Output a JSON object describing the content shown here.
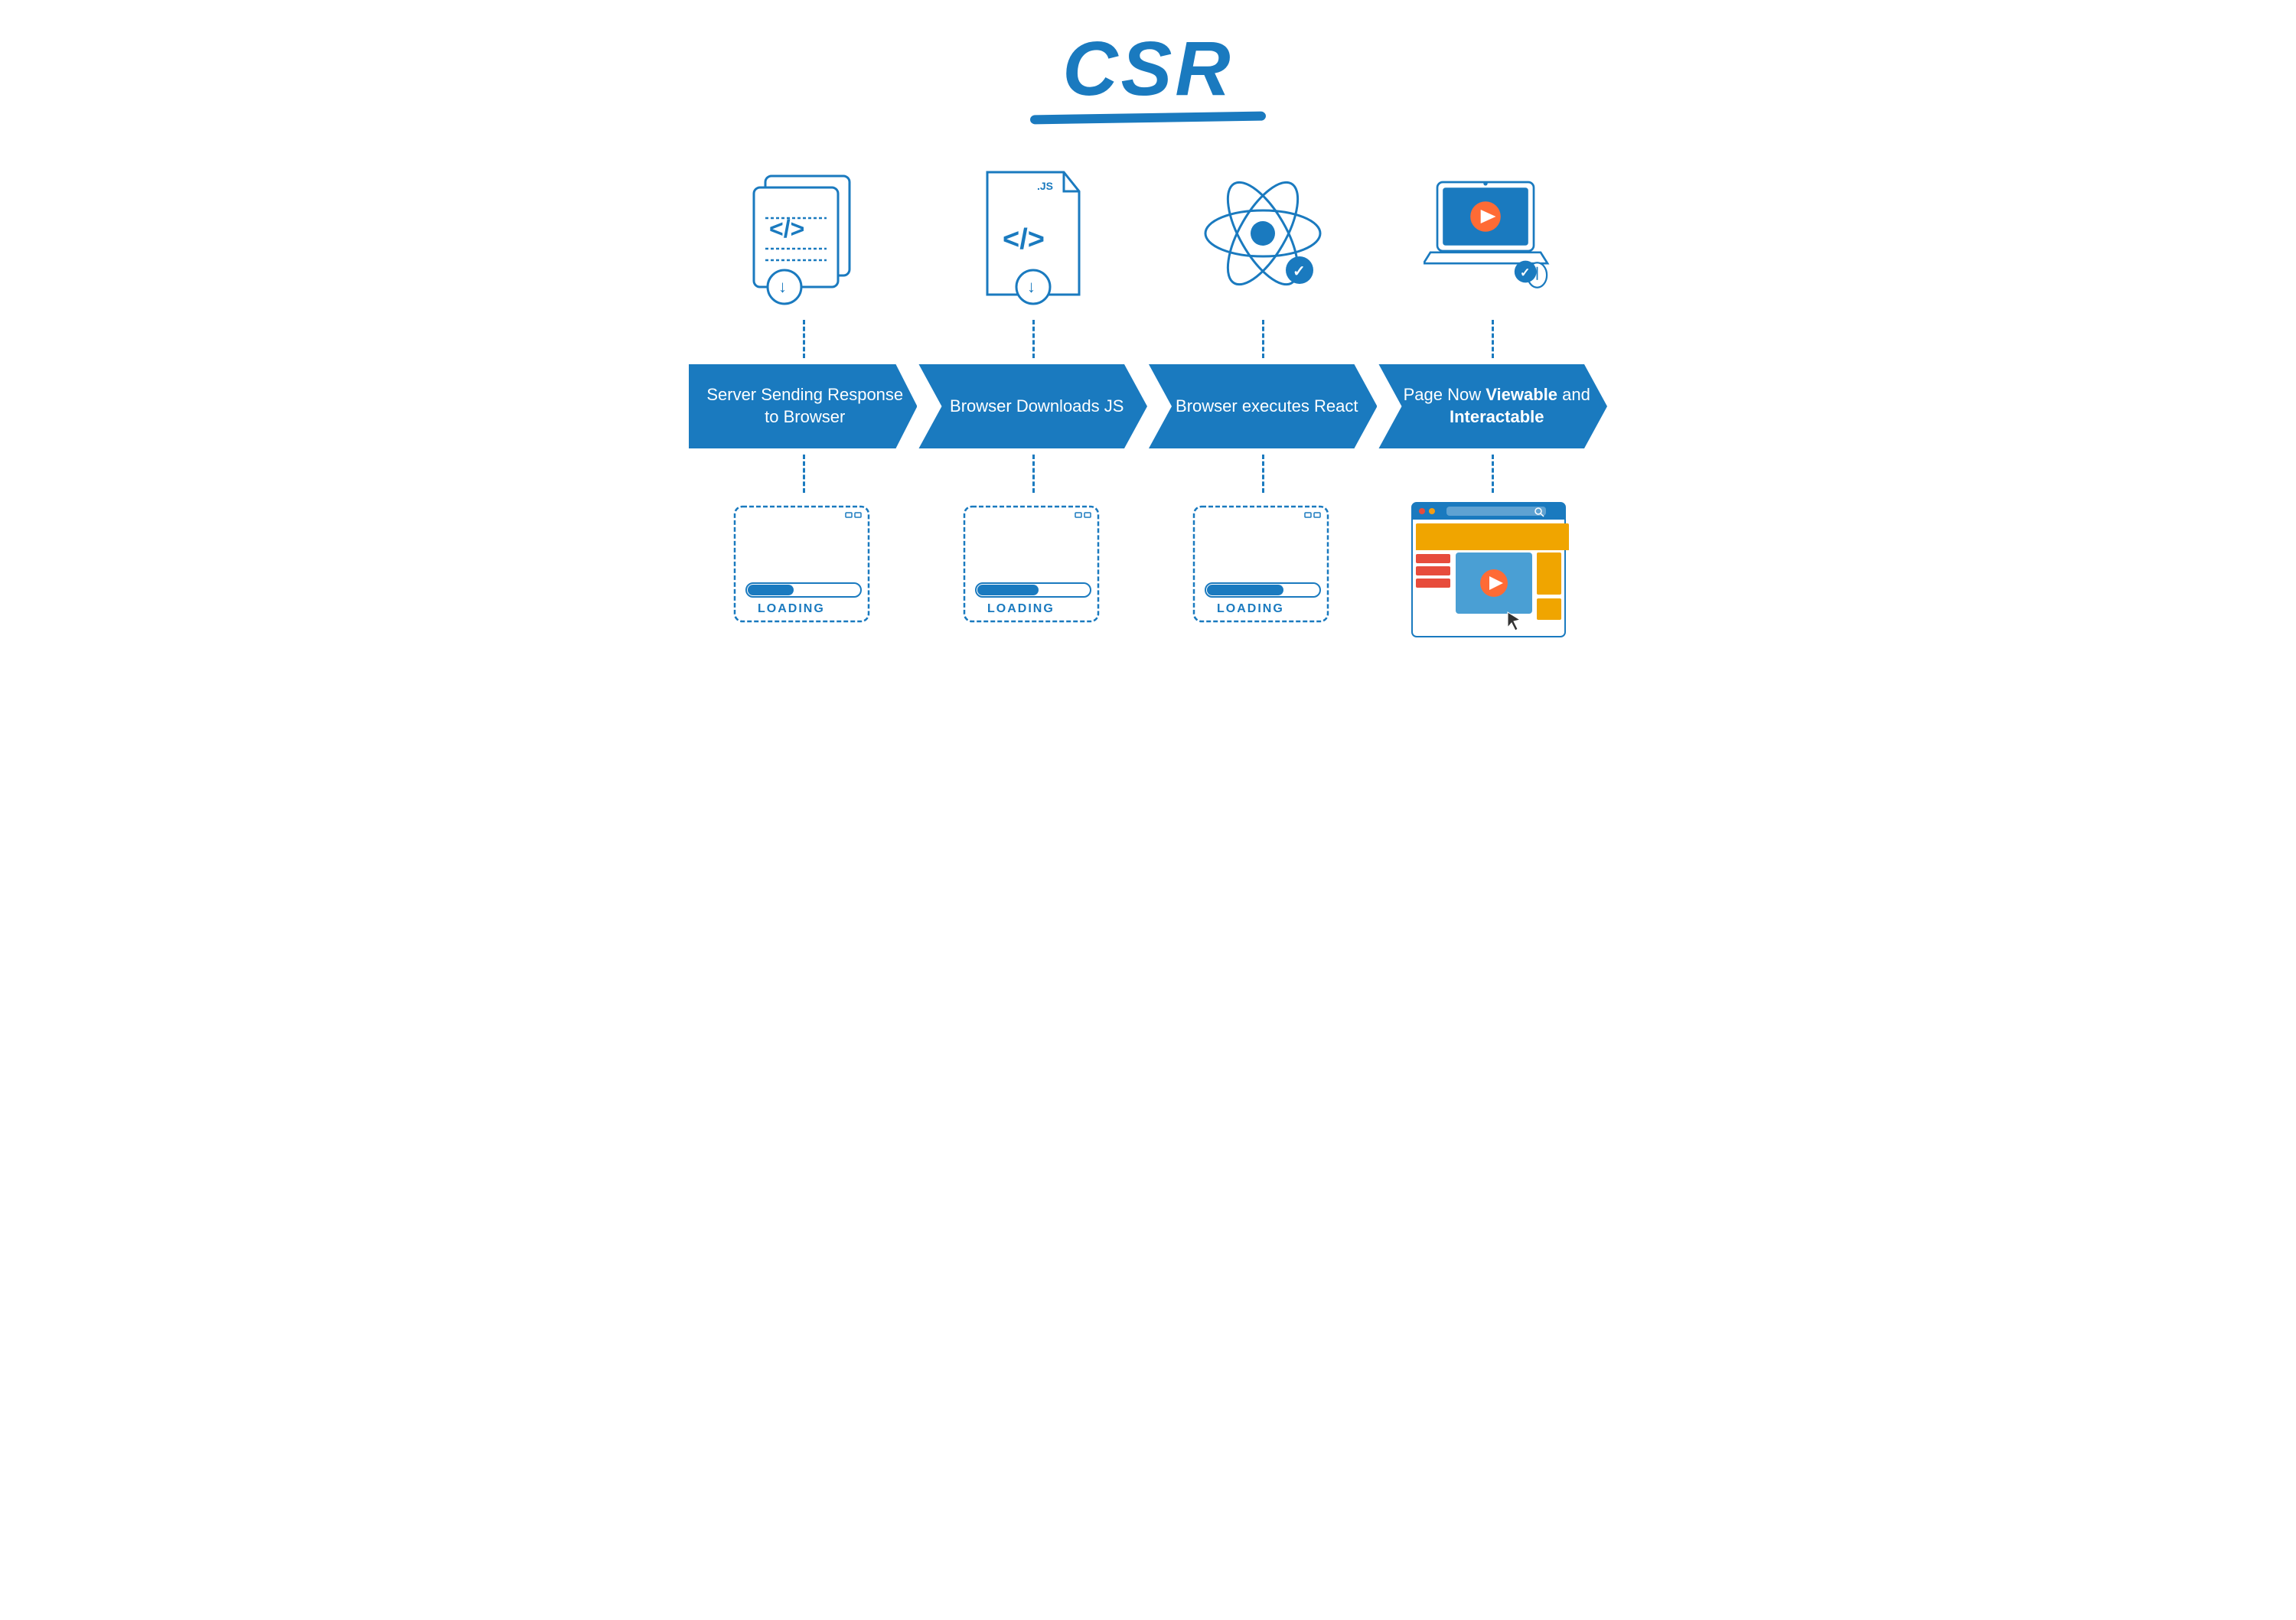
{
  "title": "CSR",
  "steps": [
    {
      "id": "step1",
      "label": "Server Sending Response to Browser",
      "bold_parts": [],
      "icon_type": "html-files",
      "bottom_icon": "loading-screen"
    },
    {
      "id": "step2",
      "label": "Browser Downloads JS",
      "bold_parts": [],
      "icon_type": "js-file",
      "bottom_icon": "loading-screen"
    },
    {
      "id": "step3",
      "label": "Browser executes React",
      "bold_parts": [],
      "icon_type": "react-atom",
      "bottom_icon": "loading-screen"
    },
    {
      "id": "step4",
      "label": "Page Now Viewable and Interactable",
      "bold_parts": [
        "Viewable",
        "Interactable"
      ],
      "icon_type": "laptop-play",
      "bottom_icon": "browser-content"
    }
  ],
  "colors": {
    "primary": "#1a7abf",
    "white": "#ffffff",
    "light_blue": "#e8f4fd"
  }
}
